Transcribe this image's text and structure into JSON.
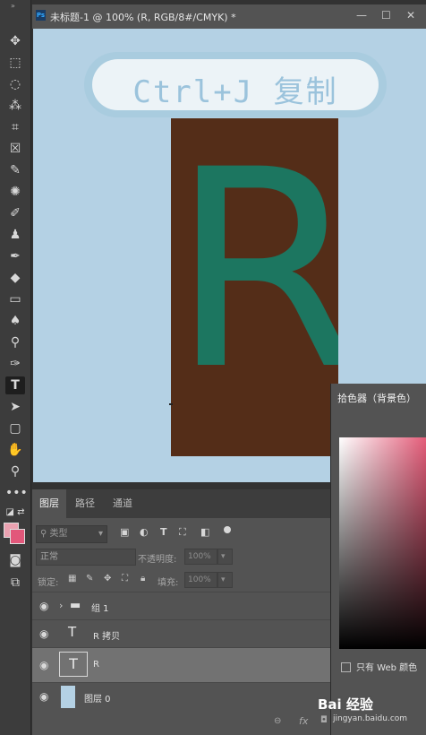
{
  "document": {
    "tab_title": "未标题-1 @ 100% (R, RGB/8#/CMYK) *",
    "badge": "Ps"
  },
  "canvas": {
    "banner_text": "Ctrl+J 复制",
    "letter": "R"
  },
  "colors": {
    "canvas_bg": "#b4d1e4",
    "banner_text": "#9bc3dc",
    "rect": "#542d18",
    "letter": "#1c7660",
    "foreground": "#eba2b1",
    "background": "#e2577a"
  },
  "layers_panel": {
    "tabs": [
      "图层",
      "路径",
      "通道"
    ],
    "active_tab": "图层",
    "filter_placeholder": "类型",
    "blend_mode": "正常",
    "opacity_label": "不透明度:",
    "opacity_value": "100%",
    "lock_label": "锁定:",
    "fill_label": "填充:",
    "fill_value": "100%",
    "layers": [
      {
        "name": "组 1",
        "type": "group",
        "visible": true,
        "selected": false
      },
      {
        "name": "R 拷贝",
        "type": "text",
        "visible": true,
        "selected": false
      },
      {
        "name": "R",
        "type": "text",
        "visible": true,
        "selected": true
      },
      {
        "name": "图层 0",
        "type": "pixel",
        "visible": true,
        "selected": false
      }
    ],
    "footer_icons": [
      "link-icon",
      "fx-icon",
      "mask-icon",
      "adjustment-icon",
      "folder-icon",
      "new-layer-icon",
      "trash-icon"
    ]
  },
  "color_picker": {
    "title": "拾色器（背景色）",
    "web_only_label": "只有 Web 颜色"
  },
  "watermark": {
    "brand": "Bai 经验",
    "url": "jingyan.baidu.com"
  }
}
